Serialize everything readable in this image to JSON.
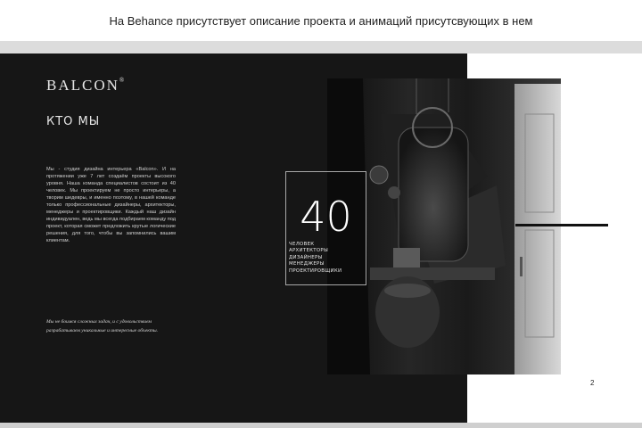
{
  "caption": "На Behance присутствует описание проекта и анимаций присутсвующих в нем",
  "slide": {
    "logo_text": "BALCON",
    "logo_mark": "®",
    "section_title": "КТО МЫ",
    "body_text": "Мы - студия дизайна интерьера «Balcon». И на протяжении уже 7 лет создаём проекты высокого уровня. Наша команда специалистов состоит из 40 человек. Мы проектируем не просто интерьеры, а творим шедевры, и именно поэтому, в нашей команде только профессиональные дизайнеры, архитекторы, менеджеры и проектировщики. Каждый наш дизайн индивидуален, ведь мы всегда подбираем команду под проект, которая сможет предложить крутые логические решения, для того, чтобы вы запомнились вашим клиентам.",
    "quote": "Мы не боимся сложных задач, и с удовольствием разрабатываем уникальные и интересные объекты.",
    "stat": {
      "number": "40",
      "items": [
        "ЧЕЛОВЕК",
        "АРХИТЕКТОРЫ",
        "ДИЗАЙНЕРЫ",
        "МЕНЕДЖЕРЫ",
        "ПРОЕКТИРОВЩИКИ"
      ]
    },
    "page_number": "2",
    "photo_icon": "interior-photo-icon"
  },
  "colors": {
    "dark_panel": "#161616",
    "text_light": "#e6e6e6",
    "accent_line": "#111111"
  }
}
